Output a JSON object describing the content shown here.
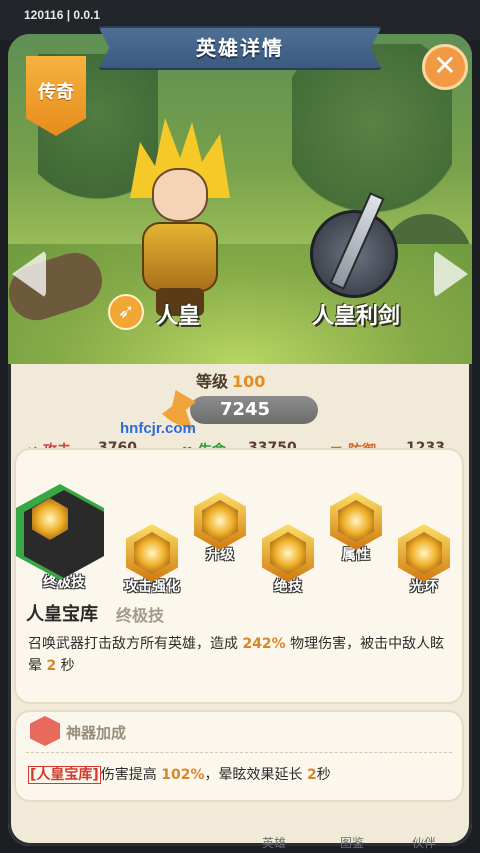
{
  "status_bar": {
    "version": "120116 | 0.0.1"
  },
  "header": {
    "title": "英雄详情",
    "close_icon": "close-icon"
  },
  "hero": {
    "rarity": "传奇",
    "name": "人皇",
    "weapon_name": "人皇利剑",
    "level_label": "等级",
    "level": "100",
    "power": "7245"
  },
  "watermark": "hnfcjr.com",
  "stats": {
    "attack_label": "攻击",
    "attack_value": "3760",
    "hp_label": "生命",
    "hp_value": "33750",
    "defense_label": "防御",
    "defense_value": "1233"
  },
  "skills": [
    {
      "label": "终极技",
      "selected": true
    },
    {
      "label": "攻击强化"
    },
    {
      "label": "升级"
    },
    {
      "label": "绝技"
    },
    {
      "label": "属性"
    },
    {
      "label": "光环"
    }
  ],
  "skill_detail": {
    "name": "人皇宝库",
    "type": "终极技",
    "desc_part1": "召唤武器打击敌方所有英雄，造成 ",
    "desc_hl1": "242%",
    "desc_part2": " 物理伤害，被击中敌人眩晕 ",
    "desc_hl2": "2",
    "desc_part3": " 秒"
  },
  "artifact": {
    "title": "神器加成",
    "tag": "[人皇宝库]",
    "effect_part1": "伤害提高 ",
    "effect_hl1": "102%",
    "effect_part2": "，晕眩效果延长 ",
    "effect_hl2": "2",
    "effect_part3": "秒"
  },
  "bottom_tabs": [
    "英雄",
    "图鉴",
    "伙伴"
  ],
  "colors": {
    "accent": "#f19a43",
    "ribbon": "#3c5a80",
    "highlight": "#d8862a"
  }
}
